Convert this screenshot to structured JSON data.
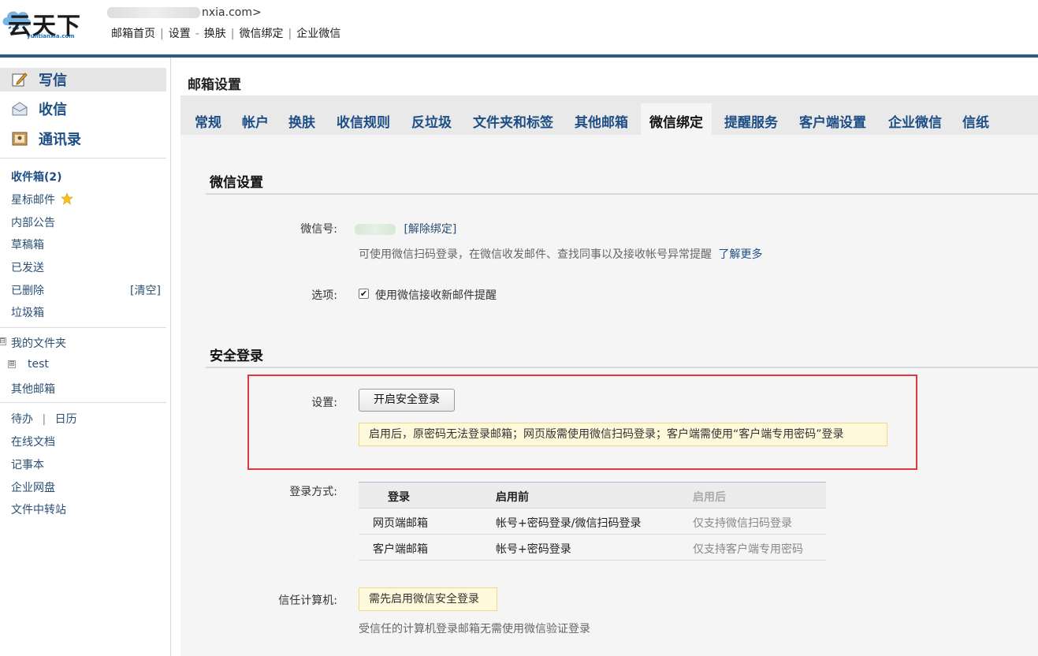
{
  "header": {
    "logo_text": "云天下",
    "logo_sub": "yuntianxia.com",
    "account_suffix": "nxia.com>",
    "links": [
      "邮箱首页",
      "设置",
      "换肤",
      "微信绑定",
      "企业微信"
    ],
    "link_seps": [
      "|",
      "-",
      "|",
      "|"
    ]
  },
  "sidebar": {
    "compose": "写信",
    "receive": "收信",
    "contacts": "通讯录",
    "folders": {
      "inbox": "收件箱(2)",
      "starred": "星标邮件",
      "notice": "内部公告",
      "drafts": "草稿箱",
      "sent": "已发送",
      "deleted": "已删除",
      "clear": "[清空]",
      "spam": "垃圾箱"
    },
    "my_folders": "我的文件夹",
    "my_folders_toggle": "⊟",
    "test_folder": "test",
    "test_toggle": "⊞",
    "other_mail": "其他邮箱",
    "todo": "待办",
    "calendar": "日历",
    "todo_sep": "|",
    "online_docs": "在线文档",
    "notes": "记事本",
    "netdisk": "企业网盘",
    "transfer": "文件中转站"
  },
  "main": {
    "title": "邮箱设置",
    "tabs": [
      "常规",
      "帐户",
      "换肤",
      "收信规则",
      "反垃圾",
      "文件夹和标签",
      "其他邮箱",
      "微信绑定",
      "提醒服务",
      "客户端设置",
      "企业微信",
      "信纸"
    ],
    "active_tab": "微信绑定",
    "wechat_section": {
      "title": "微信设置",
      "wechat_id_label": "微信号:",
      "unbind": "[解除绑定]",
      "desc": "可使用微信扫码登录，在微信收发邮件、查找同事以及接收帐号异常提醒",
      "learn_more": "了解更多",
      "options_label": "选项:",
      "checkbox_checked": "✔",
      "checkbox_label": "使用微信接收新邮件提醒"
    },
    "security_section": {
      "title": "安全登录",
      "setting_label": "设置:",
      "enable_button": "开启安全登录",
      "warning": "启用后，原密码无法登录邮箱；网页版需使用微信扫码登录；客户端需使用“客户端专用密码”登录",
      "login_method_label": "登录方式:",
      "table": {
        "headers": [
          "登录",
          "启用前",
          "启用后"
        ],
        "rows": [
          [
            "网页端邮箱",
            "帐号+密码登录/微信扫码登录",
            "仅支持微信扫码登录"
          ],
          [
            "客户端邮箱",
            "帐号+密码登录",
            "仅支持客户端专用密码"
          ]
        ]
      },
      "trusted_label": "信任计算机:",
      "trusted_badge": "需先启用微信安全登录",
      "trusted_desc": "受信任的计算机登录邮箱无需使用微信验证登录"
    }
  },
  "colors": {
    "topline": "#2f5b88",
    "link_blue": "#1e4e86",
    "highlight_red": "#e0383e",
    "notice_bg": "#fff9dc"
  }
}
